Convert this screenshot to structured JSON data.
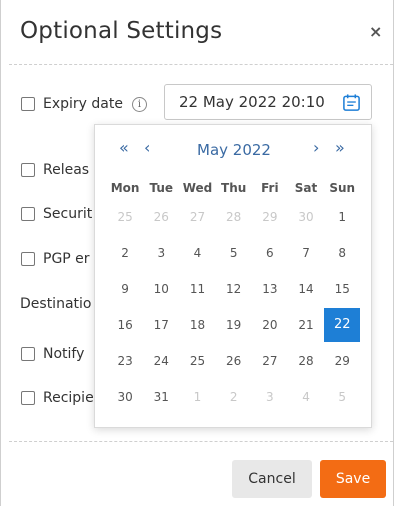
{
  "dialog": {
    "title": "Optional Settings",
    "close_glyph": "×"
  },
  "options": {
    "expiry_label": "Expiry date",
    "info_glyph": "i",
    "release_label": "Releas",
    "security_label": "Securit",
    "pgp_label": "PGP er",
    "destination_label": "Destinatio",
    "notify_label": "Notify",
    "recipient_label": "Recipie"
  },
  "expiry": {
    "value": "22 May 2022 20:10",
    "icon": "calendar-icon"
  },
  "datepicker": {
    "prev_year": "«",
    "prev_month": "‹",
    "month_label": "May 2022",
    "next_month": "›",
    "next_year": "»",
    "weekdays": [
      "Mon",
      "Tue",
      "Wed",
      "Thu",
      "Fri",
      "Sat",
      "Sun"
    ],
    "weeks": [
      [
        "25",
        "26",
        "27",
        "28",
        "29",
        "30",
        "1"
      ],
      [
        "2",
        "3",
        "4",
        "5",
        "6",
        "7",
        "8"
      ],
      [
        "9",
        "10",
        "11",
        "12",
        "13",
        "14",
        "15"
      ],
      [
        "16",
        "17",
        "18",
        "19",
        "20",
        "21",
        "22"
      ],
      [
        "23",
        "24",
        "25",
        "26",
        "27",
        "28",
        "29"
      ],
      [
        "30",
        "31",
        "1",
        "2",
        "3",
        "4",
        "5"
      ]
    ],
    "selected_day": "22",
    "selected_color": "#1e7fd6"
  },
  "footer": {
    "cancel_label": "Cancel",
    "save_label": "Save",
    "save_color": "#f36c14"
  }
}
